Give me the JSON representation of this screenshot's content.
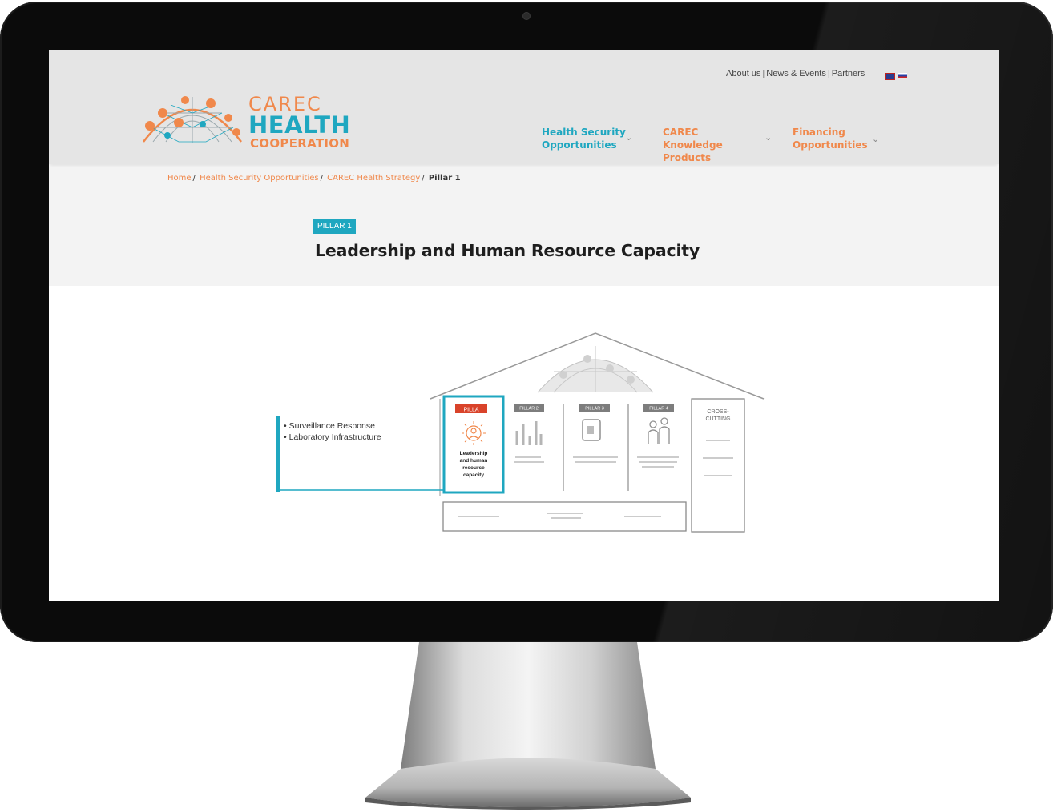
{
  "header": {
    "top_links": [
      "About us",
      "News & Events",
      "Partners"
    ],
    "logo": {
      "line1": "CAREC",
      "line2": "HEALTH",
      "line3": "COOPERATION"
    },
    "nav": [
      {
        "label": "Health Security Opportunities"
      },
      {
        "label": "CAREC Knowledge Products"
      },
      {
        "label": "Financing Opportunities"
      }
    ],
    "chevron": "⌄"
  },
  "breadcrumb": {
    "items": [
      "Home",
      "Health Security Opportunities",
      "CAREC Health Strategy"
    ],
    "current": "Pillar 1",
    "separator": "/"
  },
  "hero": {
    "badge": "PILLAR 1",
    "title": "Leadership and Human Resource Capacity"
  },
  "diagram": {
    "bullets": [
      "Surveillance Response",
      "Laboratory Infrastructure"
    ],
    "active_pillar_tag": "PILLA",
    "active_pillar_text": [
      "Leadership",
      "and human",
      "resource",
      "capacity"
    ],
    "pillar_tags": [
      "PILLAR 2",
      "PILLAR 3",
      "PILLAR 4"
    ],
    "cross_cutting": [
      "CROSS-",
      "CUTTING"
    ]
  },
  "colors": {
    "teal": "#1fa7c0",
    "orange": "#f0884b",
    "header_bg": "#e5e5e5",
    "hero_bg": "#f3f3f3"
  }
}
